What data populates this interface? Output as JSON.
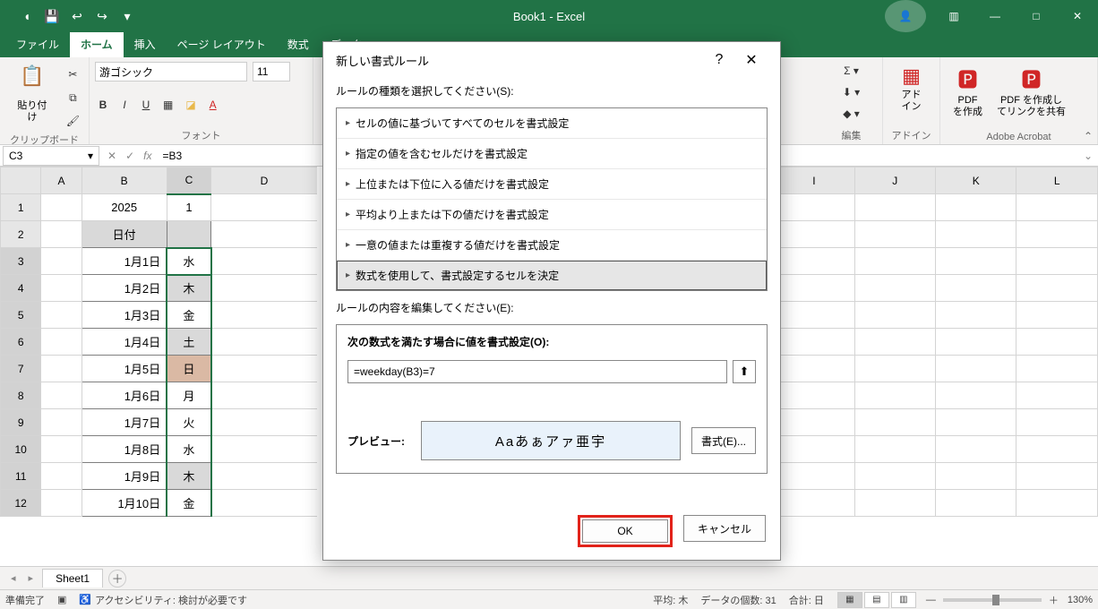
{
  "app": {
    "title": "Book1  -  Excel"
  },
  "qat": {
    "autosave": "",
    "save": "💾",
    "undo": "↩",
    "redo": "↪",
    "dd": "▾"
  },
  "tabs": {
    "file": "ファイル",
    "home": "ホーム",
    "insert": "挿入",
    "pagelayout": "ページ レイアウト",
    "formulas": "数式",
    "data": "データ"
  },
  "ribbon": {
    "paste": "貼り付け",
    "clipboard": "クリップボード",
    "font_name": "游ゴシック",
    "font_size": "11",
    "font": "フォント",
    "editing": "編集",
    "addin": "アドイン",
    "addin_label": "アド\nイン",
    "pdf_create": "PDF\nを作成",
    "pdf_share": "PDF を作成し\nてリンクを共有",
    "acrobat": "Adobe Acrobat"
  },
  "namebox": "C3",
  "formula": "=B3",
  "columns": [
    "A",
    "B",
    "C",
    "D",
    "I",
    "J",
    "K",
    "L"
  ],
  "chart_data": {
    "type": "table",
    "title": "",
    "header_row": {
      "b": "2025",
      "c": "1"
    },
    "date_header": "日付",
    "rows": [
      {
        "n": 3,
        "b": "1月1日",
        "c": "水",
        "cls": ""
      },
      {
        "n": 4,
        "b": "1月2日",
        "c": "木",
        "cls": "sat"
      },
      {
        "n": 5,
        "b": "1月3日",
        "c": "金",
        "cls": ""
      },
      {
        "n": 6,
        "b": "1月4日",
        "c": "土",
        "cls": "sat"
      },
      {
        "n": 7,
        "b": "1月5日",
        "c": "日",
        "cls": "sun"
      },
      {
        "n": 8,
        "b": "1月6日",
        "c": "月",
        "cls": ""
      },
      {
        "n": 9,
        "b": "1月7日",
        "c": "火",
        "cls": ""
      },
      {
        "n": 10,
        "b": "1月8日",
        "c": "水",
        "cls": ""
      },
      {
        "n": 11,
        "b": "1月9日",
        "c": "木",
        "cls": "sat"
      },
      {
        "n": 12,
        "b": "1月10日",
        "c": "金",
        "cls": ""
      }
    ]
  },
  "sheet_tab": "Sheet1",
  "status": {
    "ready": "準備完了",
    "accessibility": "アクセシビリティ: 検討が必要です",
    "avg": "平均: 木",
    "count": "データの個数: 31",
    "sum": "合計: 日",
    "zoom": "130%"
  },
  "dialog": {
    "title": "新しい書式ルール",
    "rule_type_label": "ルールの種類を選択してください(S):",
    "rules": [
      "セルの値に基づいてすべてのセルを書式設定",
      "指定の値を含むセルだけを書式設定",
      "上位または下位に入る値だけを書式設定",
      "平均より上または下の値だけを書式設定",
      "一意の値または重複する値だけを書式設定",
      "数式を使用して、書式設定するセルを決定"
    ],
    "edit_label": "ルールの内容を編集してください(E):",
    "formula_label": "次の数式を満たす場合に値を書式設定(O):",
    "formula_value": "=weekday(B3)=7",
    "preview_label": "プレビュー:",
    "preview_sample": "Aaあぁアァ亜宇",
    "format_btn": "書式(E)...",
    "ok": "OK",
    "cancel": "キャンセル"
  }
}
